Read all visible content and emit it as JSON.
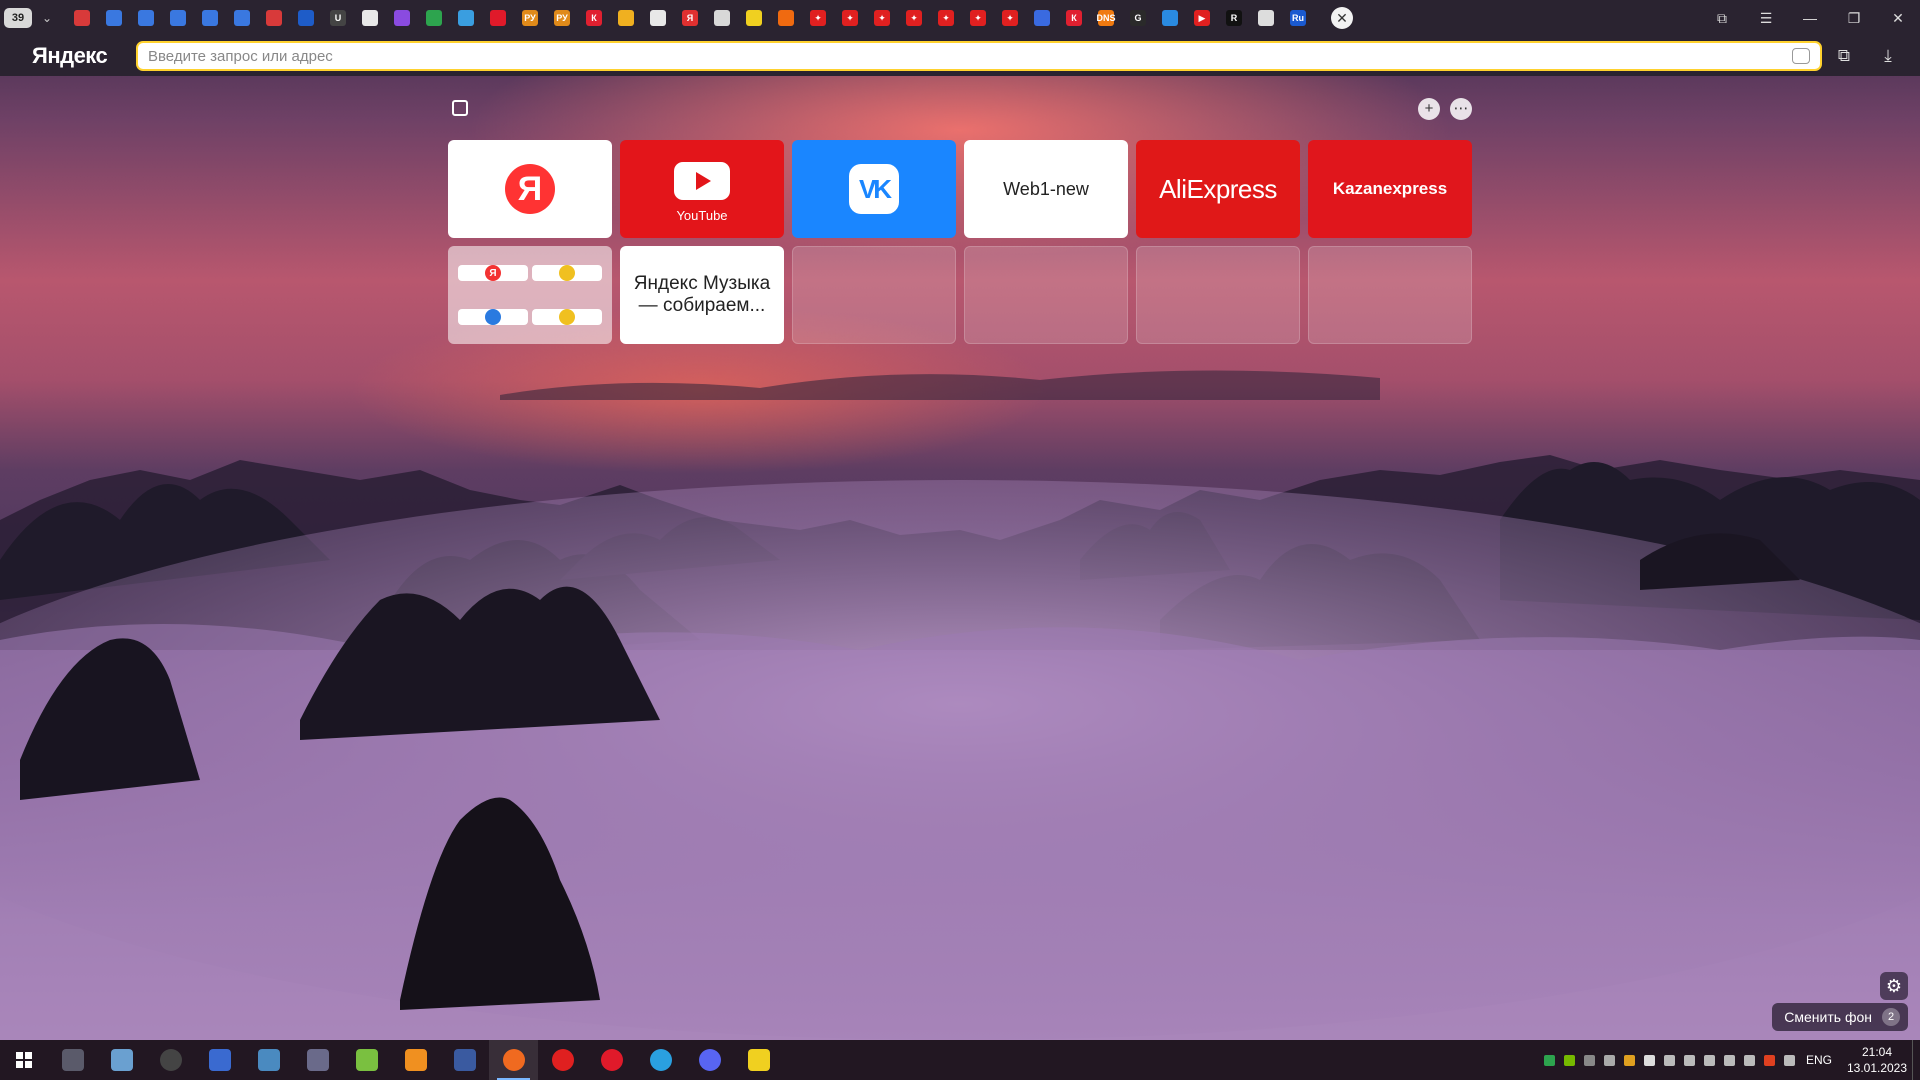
{
  "browser": {
    "tab_count": "39",
    "brand": "Яндекс",
    "address_placeholder": "Введите запрос или адрес"
  },
  "tabs": [
    {
      "icon": "pdf-icon",
      "color": "#d83a3a",
      "text": ""
    },
    {
      "icon": "blue-doc-icon",
      "color": "#3a78e0",
      "text": ""
    },
    {
      "icon": "blue-doc-icon",
      "color": "#3a78e0",
      "text": ""
    },
    {
      "icon": "blue-doc-icon",
      "color": "#3a78e0",
      "text": ""
    },
    {
      "icon": "blue-doc-icon",
      "color": "#3a78e0",
      "text": ""
    },
    {
      "icon": "blue-doc-icon",
      "color": "#3a78e0",
      "text": ""
    },
    {
      "icon": "pdf-icon",
      "color": "#d83a3a",
      "text": ""
    },
    {
      "icon": "mail-icon",
      "color": "#1e5cc8",
      "text": ""
    },
    {
      "icon": "u-icon",
      "color": "#444444",
      "text": "U"
    },
    {
      "icon": "file-icon",
      "color": "#e8e8e8",
      "text": ""
    },
    {
      "icon": "plus-icon",
      "color": "#8a4be0",
      "text": ""
    },
    {
      "icon": "drive-icon",
      "color": "#2da44e",
      "text": ""
    },
    {
      "icon": "colorful-icon",
      "color": "#3a9ee0",
      "text": ""
    },
    {
      "icon": "opera-icon",
      "color": "#e01a2a",
      "text": ""
    },
    {
      "icon": "py-icon",
      "color": "#e08a1a",
      "text": "РУ"
    },
    {
      "icon": "py-icon",
      "color": "#e08a1a",
      "text": "РУ"
    },
    {
      "icon": "k-icon",
      "color": "#e02030",
      "text": "К"
    },
    {
      "icon": "envelope-icon",
      "color": "#f0b020",
      "text": ""
    },
    {
      "icon": "file-icon",
      "color": "#e8e8e8",
      "text": ""
    },
    {
      "icon": "yandex-icon",
      "color": "#e03030",
      "text": "Я"
    },
    {
      "icon": "sheet-icon",
      "color": "#d8d8d8",
      "text": ""
    },
    {
      "icon": "smile-icon",
      "color": "#f0d020",
      "text": ""
    },
    {
      "icon": "orange-icon",
      "color": "#f06a10",
      "text": ""
    },
    {
      "icon": "star-icon",
      "color": "#e02020",
      "text": "✦"
    },
    {
      "icon": "star-icon",
      "color": "#e02020",
      "text": "✦"
    },
    {
      "icon": "star-icon",
      "color": "#e02020",
      "text": "✦"
    },
    {
      "icon": "star-icon",
      "color": "#e02020",
      "text": "✦"
    },
    {
      "icon": "star-icon",
      "color": "#e02020",
      "text": "✦"
    },
    {
      "icon": "star-icon",
      "color": "#e02020",
      "text": "✦"
    },
    {
      "icon": "star-icon",
      "color": "#e02020",
      "text": "✦"
    },
    {
      "icon": "opera-icon",
      "color": "#3a6ae0",
      "text": ""
    },
    {
      "icon": "k-icon",
      "color": "#e02030",
      "text": "К"
    },
    {
      "icon": "dns-icon",
      "color": "#f07a10",
      "text": "DNS"
    },
    {
      "icon": "g-icon",
      "color": "#2a2a2a",
      "text": "G"
    },
    {
      "icon": "chat-icon",
      "color": "#2a8ae0",
      "text": ""
    },
    {
      "icon": "youtube-icon",
      "color": "#e02020",
      "text": "▶"
    },
    {
      "icon": "r-icon",
      "color": "#111111",
      "text": "R"
    },
    {
      "icon": "book-icon",
      "color": "#dddddd",
      "text": ""
    },
    {
      "icon": "ru-icon",
      "color": "#1a5ad0",
      "text": "Ru"
    }
  ],
  "tiles": [
    {
      "kind": "yandex",
      "label": "Я"
    },
    {
      "kind": "youtube",
      "label": "YouTube"
    },
    {
      "kind": "vk",
      "label": "VK"
    },
    {
      "kind": "text",
      "label": "Web1-new"
    },
    {
      "kind": "aliexpress",
      "label": "AliExpress"
    },
    {
      "kind": "kazan",
      "label": "Kazanexpress"
    },
    {
      "kind": "folder",
      "label": ""
    },
    {
      "kind": "music",
      "label": "Яндекс Музыка — собираем..."
    },
    {
      "kind": "empty",
      "label": ""
    },
    {
      "kind": "empty",
      "label": ""
    },
    {
      "kind": "empty",
      "label": ""
    },
    {
      "kind": "empty",
      "label": ""
    }
  ],
  "folder_items": [
    {
      "icon": "yandex-icon",
      "color": "#f33333",
      "text": "Я"
    },
    {
      "icon": "smile-icon",
      "color": "#f0c020",
      "text": ""
    },
    {
      "icon": "blue-circle-icon",
      "color": "#2a7ae0",
      "text": ""
    },
    {
      "icon": "pie-icon",
      "color": "#f0c020",
      "text": ""
    }
  ],
  "background": {
    "change_label": "Сменить фон",
    "change_count": "2"
  },
  "taskbar": {
    "apps": [
      {
        "icon": "taskbar-app-icon",
        "color": "#5a5a6a"
      },
      {
        "icon": "explorer-icon",
        "color": "#6aa0d0"
      },
      {
        "icon": "obs-icon",
        "color": "#444444"
      },
      {
        "icon": "word-icon",
        "color": "#3a6ad0"
      },
      {
        "icon": "network-icon",
        "color": "#4a8ac0"
      },
      {
        "icon": "remote-icon",
        "color": "#6a6a8a"
      },
      {
        "icon": "notepad-icon",
        "color": "#7ac040"
      },
      {
        "icon": "sublime-icon",
        "color": "#f09020"
      },
      {
        "icon": "floppy-icon",
        "color": "#3a5aa0"
      },
      {
        "icon": "firefox-icon",
        "color": "#f06a20"
      },
      {
        "icon": "yandex-browser-icon",
        "color": "#e02020"
      },
      {
        "icon": "opera-icon",
        "color": "#e01a2a"
      },
      {
        "icon": "telegram-icon",
        "color": "#2aa0e0"
      },
      {
        "icon": "discord-icon",
        "color": "#5865f2"
      },
      {
        "icon": "triangle-app-icon",
        "color": "#f0d020"
      }
    ],
    "language": "ENG",
    "time": "21:04",
    "date": "13.01.2023"
  },
  "tray_icons": [
    {
      "icon": "tray-green-icon",
      "color": "#2da44e"
    },
    {
      "icon": "nvidia-icon",
      "color": "#76b900"
    },
    {
      "icon": "obs-tray-icon",
      "color": "#888888"
    },
    {
      "icon": "quote-icon",
      "color": "#aaaaaa"
    },
    {
      "icon": "chrome-tray-icon",
      "color": "#e0a020"
    },
    {
      "icon": "windows-tray-icon",
      "color": "#dddddd"
    },
    {
      "icon": "camera-tray-icon",
      "color": "#bbbbbb"
    },
    {
      "icon": "battery-icon",
      "color": "#bbbbbb"
    },
    {
      "icon": "mic-icon",
      "color": "#bbbbbb"
    },
    {
      "icon": "display-icon",
      "color": "#bbbbbb"
    },
    {
      "icon": "wifi-icon",
      "color": "#bbbbbb"
    },
    {
      "icon": "flame-icon",
      "color": "#e04020"
    },
    {
      "icon": "volume-icon",
      "color": "#bbbbbb"
    }
  ]
}
